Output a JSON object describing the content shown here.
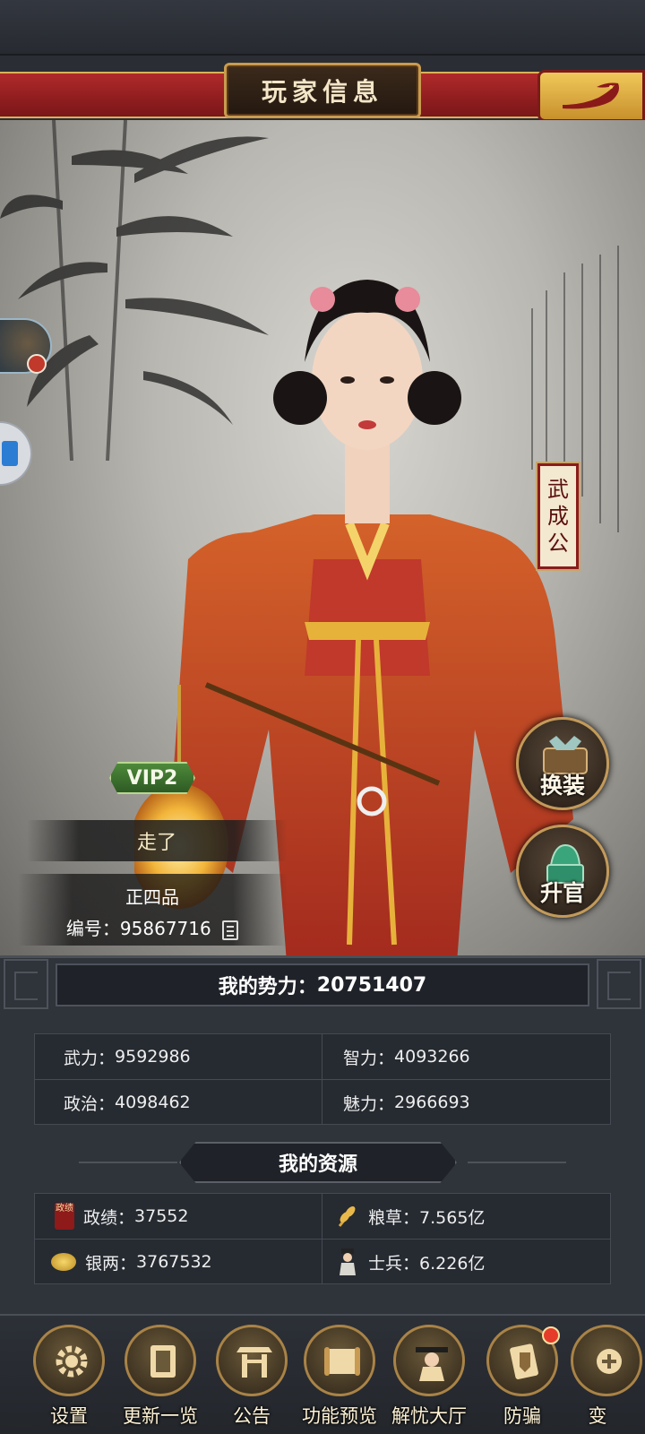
{
  "header": {
    "title": "玩家信息",
    "back_icon": "dragon-back-icon"
  },
  "portrait": {
    "official_title": [
      "武",
      "成",
      "公"
    ],
    "vip": "VIP2",
    "player_name": "走了",
    "rank": "正四品",
    "id_label": "编号：",
    "id_value": "95867716",
    "dress_button": "换装",
    "promote_button": "升官"
  },
  "power": {
    "label": "我的势力：",
    "value": "20751407"
  },
  "attributes": [
    {
      "label": "武力：",
      "value": "9592986"
    },
    {
      "label": "智力：",
      "value": "4093266"
    },
    {
      "label": "政治：",
      "value": "4098462"
    },
    {
      "label": "魅力：",
      "value": "2966693"
    }
  ],
  "resources_title": "我的资源",
  "resources": [
    {
      "label": "政绩：",
      "value": "37552",
      "icon": "merit-icon",
      "icon_text": "政绩"
    },
    {
      "label": "粮草：",
      "value": "7.565亿",
      "icon": "grain-icon"
    },
    {
      "label": "银两：",
      "value": "3767532",
      "icon": "silver-coin-icon"
    },
    {
      "label": "士兵：",
      "value": "6.226亿",
      "icon": "soldier-icon"
    }
  ],
  "bottom_nav": [
    {
      "label": "设置",
      "icon": "gear-icon"
    },
    {
      "label": "更新一览",
      "icon": "book-icon"
    },
    {
      "label": "公告",
      "icon": "gate-icon"
    },
    {
      "label": "功能预览",
      "icon": "scroll-icon"
    },
    {
      "label": "解忧大厅",
      "icon": "official-icon"
    },
    {
      "label": "防骗",
      "icon": "shield-card-icon"
    },
    {
      "label": "变",
      "icon": "change-icon"
    }
  ],
  "colors": {
    "band_red": "#a52526",
    "gold": "#d9b15a",
    "panel": "#2f333a"
  }
}
